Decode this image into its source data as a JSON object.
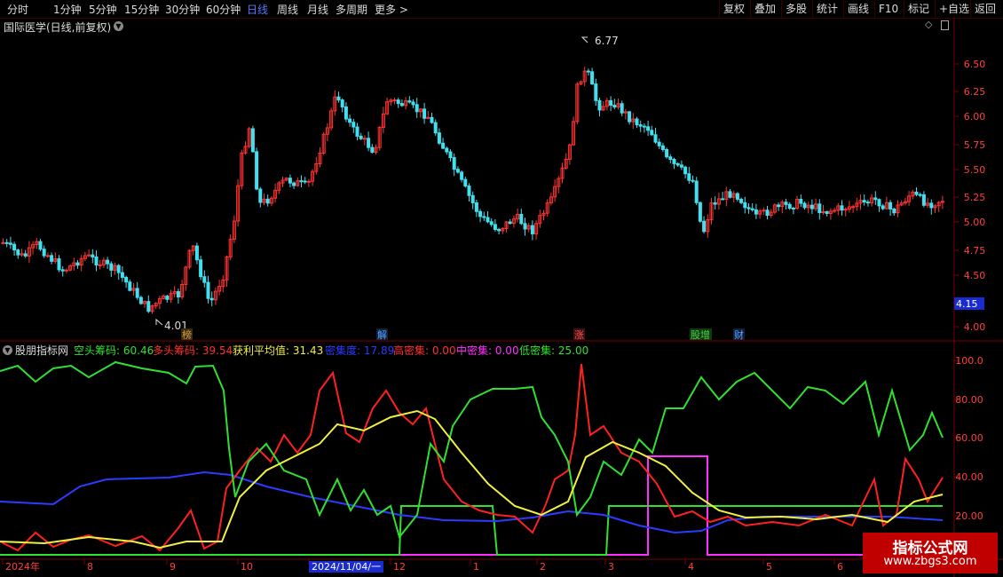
{
  "toolbar": {
    "periods": [
      "分时",
      "1分钟",
      "5分钟",
      "15分钟",
      "30分钟",
      "60分钟",
      "日线",
      "周线",
      "月线",
      "多周期",
      "更多 >"
    ],
    "active_period": "日线",
    "right_buttons": [
      "复权",
      "叠加",
      "多股",
      "统计",
      "画线",
      "F10",
      "标记",
      "+自选",
      "返回"
    ]
  },
  "stock_title": "国际医学(日线,前复权)",
  "price_axis": {
    "ticks": [
      "6.50",
      "6.25",
      "6.00",
      "5.75",
      "5.50",
      "5.25",
      "5.00",
      "4.75",
      "4.50",
      "4.00"
    ]
  },
  "current_price": "4.15",
  "price_markers": {
    "high": "6.77",
    "low": "4.01"
  },
  "event_tags": [
    {
      "text": "榜",
      "color": "#d8a040"
    },
    {
      "text": "解",
      "color": "#5aa0ff"
    },
    {
      "text": "涨",
      "color": "#ff5050"
    },
    {
      "text": "股增",
      "color": "#4ad04a"
    },
    {
      "text": "财",
      "color": "#5aa0ff"
    }
  ],
  "indicator": {
    "name": "股朋指标网",
    "items": [
      {
        "label": "空头筹码: 60.46",
        "color": "#30e030"
      },
      {
        "label": "多头筹码: 39.54",
        "color": "#ff3030"
      },
      {
        "label": "获利平均值: 31.43",
        "color": "#f0f040"
      },
      {
        "label": "密集度: 17.89",
        "color": "#2a3cff"
      },
      {
        "label": "高密集: 0.00",
        "color": "#ff3030"
      },
      {
        "label": "中密集: 0.00",
        "color": "#ff30ff"
      },
      {
        "label": "低密集: 25.00",
        "color": "#30e030"
      }
    ],
    "axis_ticks": [
      "100.0",
      "80.00",
      "60.00",
      "40.00",
      "20.00"
    ]
  },
  "date_axis": {
    "labels": [
      "2024年",
      "8",
      "9",
      "10",
      "1",
      "12",
      "1",
      "2",
      "3",
      "4",
      "5",
      "6"
    ],
    "cursor_date": "2024/11/04/一"
  },
  "watermark": {
    "title": "指标公式网",
    "url": "www.zbgs3.com"
  },
  "colors": {
    "up": "#ff3333",
    "down": "#40e0f0",
    "axis": "#7a0000",
    "background": "#000000"
  },
  "icons": [
    "chevron-down-icon",
    "diamond-icon",
    "scroll-icon",
    "chevron-right-icon"
  ]
}
